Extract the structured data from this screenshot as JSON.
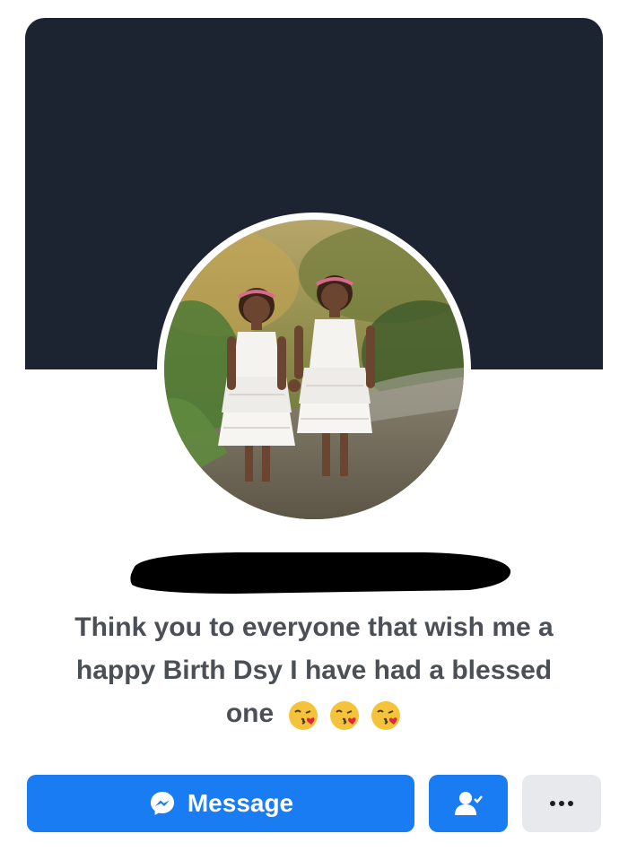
{
  "profile": {
    "bio_line1": "Think you to everyone that wish me a",
    "bio_line2": "happy Birth Dsy I have had a blessed",
    "bio_line3": "one",
    "bio_emojis": [
      "face-blowing-a-kiss",
      "face-blowing-a-kiss",
      "face-blowing-a-kiss"
    ]
  },
  "actions": {
    "message_label": "Message",
    "message_icon": "messenger-icon",
    "friend_icon": "friends-check-icon",
    "more_icon": "more-dots-icon"
  },
  "colors": {
    "cover": "#1d2431",
    "primary_button": "#1a7cf2",
    "secondary_button": "#e7e9ed",
    "bio_text": "#4b4f56"
  }
}
